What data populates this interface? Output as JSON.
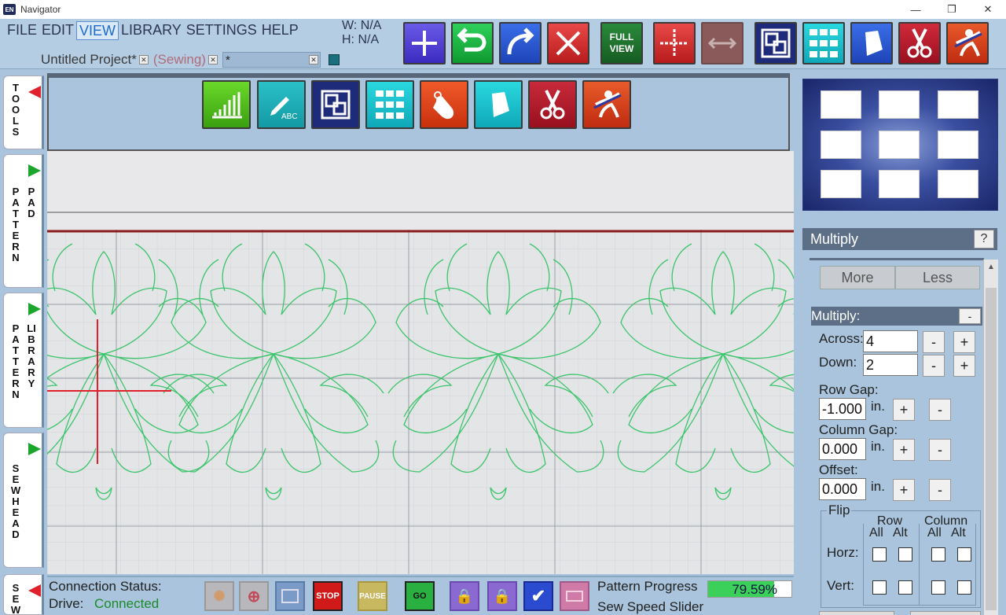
{
  "window": {
    "title": "Navigator",
    "app_icon": "EN"
  },
  "menu": [
    "FILE",
    "EDIT",
    "VIEW",
    "LIBRARY",
    "SETTINGS",
    "HELP"
  ],
  "dims": {
    "w": "W: N/A",
    "h": "H: N/A"
  },
  "project_tabs": {
    "tab1": "Untitled Project*",
    "tab2": "(Sewing)",
    "field": "*"
  },
  "toolbar": {
    "full_view": "FULL VIEW"
  },
  "tools_buttons": [
    "pattern-stats-icon",
    "text-abc-icon",
    "resize-icon",
    "multiply-icon",
    "hand-move-icon",
    "crop-icon",
    "cut-icon",
    "rider-icon"
  ],
  "side_tabs": {
    "tools": "TOOLS",
    "pattern_pad": [
      "PATTERN",
      "PAD"
    ],
    "pattern_library": [
      "PATTERN",
      "LIBRARY"
    ],
    "sewhead": "SEWHEAD",
    "sew": "SEW"
  },
  "multiply": {
    "header": "Multiply",
    "help": "?",
    "more": "More",
    "less": "Less",
    "section": "Multiply:",
    "collapse": "-",
    "across_label": "Across:",
    "across_value": "4",
    "down_label": "Down:",
    "down_value": "2",
    "row_gap_label": "Row Gap:",
    "row_gap_value": "-1.000",
    "column_gap_label": "Column Gap:",
    "column_gap_value": "0.000",
    "offset_label": "Offset:",
    "offset_value": "0.000",
    "unit": "in.",
    "plus": "+",
    "minus": "-",
    "flip_label": "Flip",
    "row_label": "Row",
    "column_label": "Column",
    "all": "All",
    "alt": "Alt",
    "horz": "Horz:",
    "vert": "Vert:"
  },
  "status": {
    "connection_label": "Connection Status:",
    "drive_label": "Drive:",
    "drive_value": "Connected",
    "stop": "STOP",
    "pause": "PAUSE",
    "go": "GO",
    "progress_label": "Pattern Progress",
    "progress_value": "79.59%",
    "progress_fraction": 0.7959,
    "speed_label": "Sew Speed Slider"
  },
  "colors": {
    "accent_green": "#3ad05a",
    "connected": "#1a8a2a",
    "stitch": "#39c46a",
    "cursor": "#e0202a"
  }
}
